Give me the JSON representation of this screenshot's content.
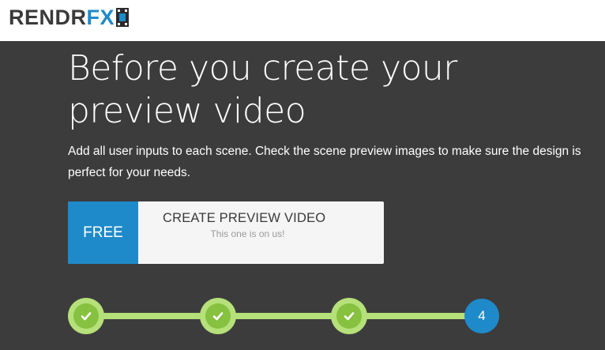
{
  "header": {
    "logo_main": "RENDR",
    "logo_accent": "FX",
    "logo_icon": "film-strip-icon"
  },
  "main": {
    "title": "Before you create your preview video",
    "description": "Add all user inputs to each scene. Check the scene preview images to make sure the design is perfect for your needs."
  },
  "cta": {
    "badge": "FREE",
    "title": "CREATE PREVIEW VIDEO",
    "subtitle": "This one is on us!"
  },
  "stepper": {
    "steps": [
      {
        "state": "done",
        "icon": "check-icon"
      },
      {
        "state": "done",
        "icon": "check-icon"
      },
      {
        "state": "done",
        "icon": "check-icon"
      },
      {
        "state": "current",
        "label": "4"
      }
    ]
  },
  "colors": {
    "brand_blue": "#1f8ac9",
    "background": "#3c3c3c",
    "step_ring": "#b5e07a",
    "step_fill": "#86c140"
  }
}
